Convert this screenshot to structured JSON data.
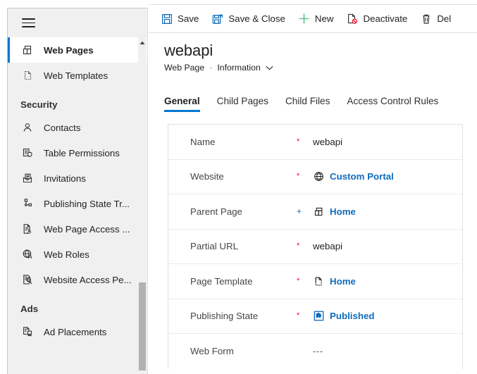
{
  "sidebar": {
    "menu_button": "menu-hamburger",
    "items": [
      {
        "type": "item",
        "label": "Web Pages",
        "icon": "web-pages-icon",
        "selected": true
      },
      {
        "type": "item",
        "label": "Web Templates",
        "icon": "web-templates-icon",
        "selected": false
      },
      {
        "type": "group",
        "label": "Security"
      },
      {
        "type": "item",
        "label": "Contacts",
        "icon": "contacts-icon",
        "selected": false
      },
      {
        "type": "item",
        "label": "Table  Permissions",
        "icon": "table-permissions-icon",
        "selected": false
      },
      {
        "type": "item",
        "label": "Invitations",
        "icon": "invitations-icon",
        "selected": false
      },
      {
        "type": "item",
        "label": "Publishing State Tr...",
        "icon": "publishing-state-icon",
        "selected": false
      },
      {
        "type": "item",
        "label": "Web Page Access ...",
        "icon": "web-page-access-icon",
        "selected": false
      },
      {
        "type": "item",
        "label": "Web Roles",
        "icon": "web-roles-icon",
        "selected": false
      },
      {
        "type": "item",
        "label": "Website Access Pe...",
        "icon": "website-access-icon",
        "selected": false
      },
      {
        "type": "group",
        "label": "Ads"
      },
      {
        "type": "item",
        "label": "Ad Placements",
        "icon": "ad-placements-icon",
        "selected": false
      }
    ],
    "accent_color": "#0078d4",
    "background": "#f0f0f0"
  },
  "commandbar": {
    "commands": [
      {
        "label": "Save",
        "icon": "save-icon"
      },
      {
        "label": "Save & Close",
        "icon": "save-close-icon"
      },
      {
        "label": "New",
        "icon": "plus-icon"
      },
      {
        "label": "Deactivate",
        "icon": "deactivate-icon"
      },
      {
        "label": "Del",
        "icon": "delete-icon"
      }
    ]
  },
  "record": {
    "title": "webapi",
    "entity": "Web Page",
    "separator": "·",
    "form_name": "Information",
    "form_chevron": "chevron-down-icon"
  },
  "tabs": [
    {
      "label": "General",
      "active": true
    },
    {
      "label": "Child Pages",
      "active": false
    },
    {
      "label": "Child Files",
      "active": false
    },
    {
      "label": "Access Control Rules",
      "active": false
    }
  ],
  "form": {
    "fields": [
      {
        "label": "Name",
        "required": "star",
        "value": "webapi",
        "kind": "text"
      },
      {
        "label": "Website",
        "required": "star",
        "value": "Custom Portal",
        "kind": "lookup",
        "icon": "globe-icon"
      },
      {
        "label": "Parent Page",
        "required": "plus",
        "value": "Home",
        "kind": "lookup",
        "icon": "web-pages-icon"
      },
      {
        "label": "Partial URL",
        "required": "star",
        "value": "webapi",
        "kind": "text"
      },
      {
        "label": "Page Template",
        "required": "star",
        "value": "Home",
        "kind": "lookup",
        "icon": "page-template-icon"
      },
      {
        "label": "Publishing State",
        "required": "star",
        "value": "Published",
        "kind": "lookup",
        "icon": "publishing-state-badge-icon"
      },
      {
        "label": "Web Form",
        "required": "none",
        "value": "---",
        "kind": "empty"
      }
    ],
    "required_marker": "*",
    "recommended_marker": "+",
    "required_color": "#e81123",
    "recommended_color": "#0f6cbd",
    "link_color": "#0f6cbd"
  }
}
